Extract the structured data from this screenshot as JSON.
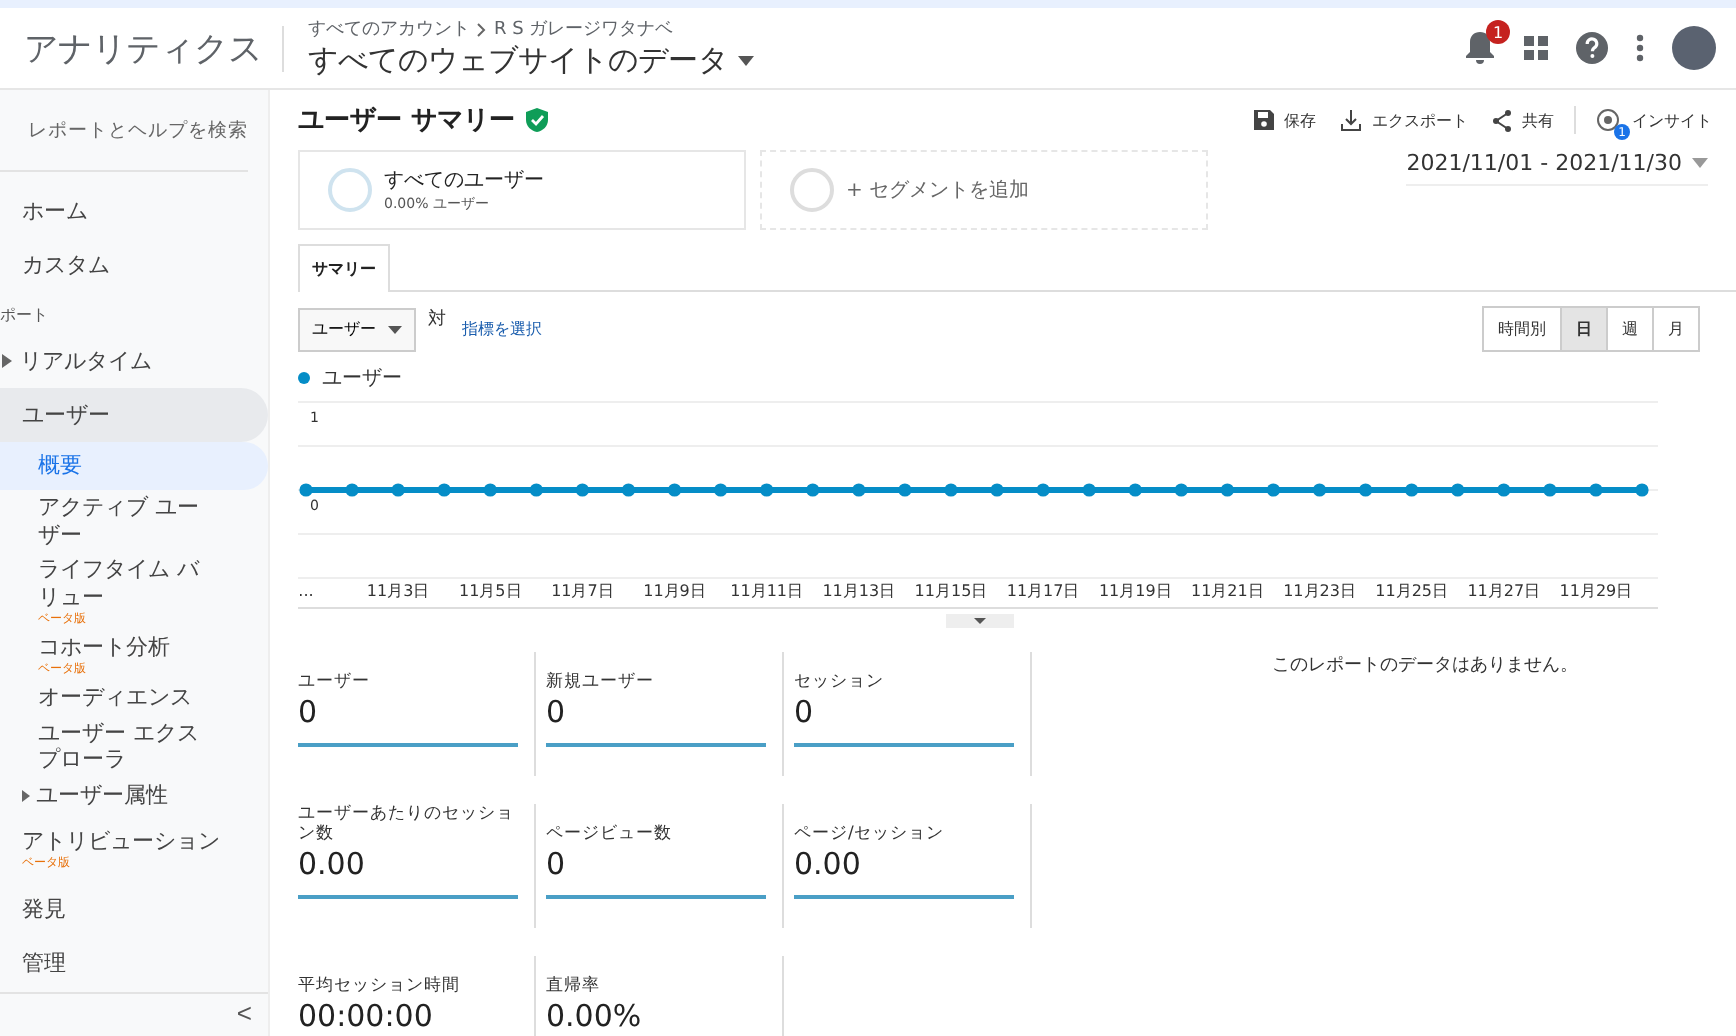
{
  "header": {
    "app_title": "アナリティクス",
    "breadcrumb": [
      "すべてのアカウント",
      "R S ガレージワタナベ"
    ],
    "property": "すべてのウェブサイトのデータ",
    "notification_count": "1"
  },
  "sidebar": {
    "search": {
      "placeholder": "レポートとヘルプを検索"
    },
    "items": [
      {
        "kind": "link",
        "label": "ホーム",
        "selected": false
      },
      {
        "kind": "link",
        "label": "カスタム",
        "selected": false
      },
      {
        "kind": "section",
        "label": "ポート"
      },
      {
        "kind": "group",
        "label": "リアルタイム",
        "selected": false,
        "expanded": false
      },
      {
        "kind": "group",
        "label": "ユーザー",
        "selected": false,
        "expanded": true,
        "children": [
          {
            "label": "概要",
            "selected": true
          },
          {
            "label": "アクティブ ユーザー",
            "selected": false
          },
          {
            "label": "ライフタイム バリュー",
            "selected": false,
            "badge": "ベータ版"
          },
          {
            "label": "コホート分析",
            "selected": false,
            "badge": "ベータ版"
          },
          {
            "label": "オーディエンス",
            "selected": false
          },
          {
            "label": "ユーザー エクスプローラ",
            "selected": false
          },
          {
            "label": "ユーザー属性",
            "selected": false,
            "expanded": false
          }
        ]
      },
      {
        "kind": "link",
        "label": "アトリビューション",
        "selected": false,
        "badge": "ベータ版"
      },
      {
        "kind": "link",
        "label": "発見",
        "selected": false
      },
      {
        "kind": "link",
        "label": "管理",
        "selected": false
      }
    ],
    "collapse": "<"
  },
  "report": {
    "title": "ユーザー サマリー",
    "verified": true,
    "actions": [
      {
        "kind": "save",
        "label": "保存"
      },
      {
        "kind": "export",
        "label": "エクスポート"
      },
      {
        "kind": "share",
        "label": "共有"
      },
      {
        "kind": "insight",
        "label": "インサイト",
        "badge": "1"
      }
    ],
    "segments": [
      {
        "kind": "segment",
        "title": "すべてのユーザー",
        "subtitle": "0.00% ユーザー"
      },
      {
        "kind": "add",
        "title": "+ セグメントを追加"
      }
    ],
    "date_range": "2021/11/01 - 2021/11/30",
    "tabs": [
      {
        "label": "サマリー",
        "selected": true
      }
    ],
    "metric_select": "ユーザー",
    "versus": "対",
    "choose_metric": "指標を選択",
    "granularity": [
      {
        "label": "時間別",
        "selected": false
      },
      {
        "label": "日",
        "selected": true
      },
      {
        "label": "週",
        "selected": false
      },
      {
        "label": "月",
        "selected": false
      }
    ],
    "chart_data": {
      "type": "line",
      "categories": [
        "...",
        null,
        "11月3日",
        null,
        "11月5日",
        null,
        "11月7日",
        null,
        "11月9日",
        null,
        "11月11日",
        null,
        "11月13日",
        null,
        "11月15日",
        null,
        "11月17日",
        null,
        "11月19日",
        null,
        "11月21日",
        null,
        "11月23日",
        null,
        "11月25日",
        null,
        "11月27日",
        null,
        "11月29日",
        null
      ],
      "series": [
        {
          "name": "ユーザー",
          "color": "#058dc7",
          "marker": true,
          "values": [
            0,
            0,
            0,
            0,
            0,
            0,
            0,
            0,
            0,
            0,
            0,
            0,
            0,
            0,
            0,
            0,
            0,
            0,
            0,
            0,
            0,
            0,
            0,
            0,
            0,
            0,
            0,
            0,
            0,
            0
          ]
        }
      ],
      "ylim": [
        -1,
        1
      ],
      "yticks": [
        0,
        1
      ]
    },
    "metrics": [
      {
        "label": "ユーザー",
        "value": "0"
      },
      {
        "label": "新規ユーザー",
        "value": "0"
      },
      {
        "label": "セッション",
        "value": "0"
      },
      {
        "label": "ユーザーあたりのセッション数",
        "value": "0.00"
      },
      {
        "label": "ページビュー数",
        "value": "0"
      },
      {
        "label": "ページ/セッション",
        "value": "0.00"
      },
      {
        "label": "平均セッション時間",
        "value": "00:00:00"
      },
      {
        "label": "直帰率",
        "value": "0.00%"
      }
    ],
    "no_data": "このレポートのデータはありません。"
  }
}
